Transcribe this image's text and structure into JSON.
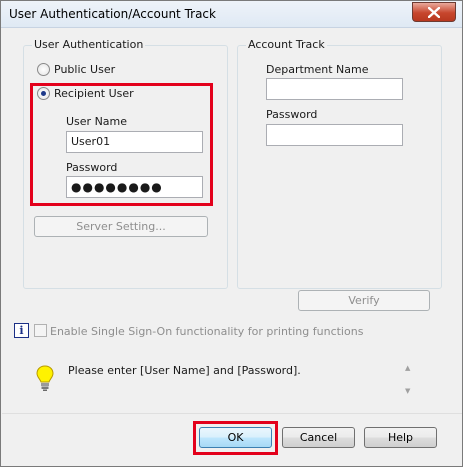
{
  "window": {
    "title": "User Authentication/Account Track"
  },
  "user_auth": {
    "legend": "User Authentication",
    "public_user_label": "Public User",
    "recipient_user_label": "Recipient User",
    "selected": "recipient",
    "user_name_label": "User Name",
    "user_name_value": "User01",
    "password_label": "Password",
    "password_value": "●●●●●●●●",
    "server_setting_label": "Server Setting..."
  },
  "account_track": {
    "legend": "Account Track",
    "department_name_label": "Department Name",
    "department_name_value": "",
    "password_label": "Password",
    "password_value": "",
    "verify_label": "Verify"
  },
  "sso": {
    "icon_letter": "i",
    "label": "Enable Single Sign-On functionality for printing functions"
  },
  "message": {
    "text": "Please enter [User Name] and [Password]."
  },
  "buttons": {
    "ok": "OK",
    "cancel": "Cancel",
    "help": "Help"
  },
  "colors": {
    "highlight": "#e3001b",
    "accent": "#3c7fb1"
  },
  "icons": {
    "close": "close-icon",
    "info": "info-icon",
    "hint": "lightbulb-icon"
  }
}
